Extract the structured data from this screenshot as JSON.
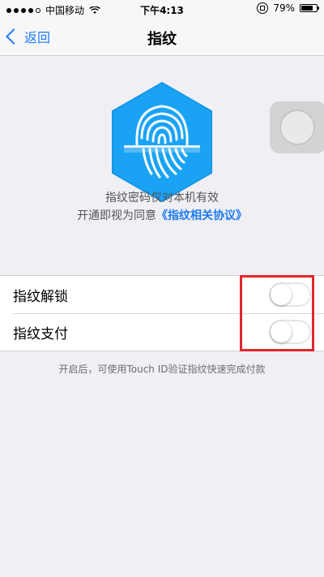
{
  "status_bar": {
    "carrier": "中国移动",
    "time": "下午4:13",
    "battery_percent": "79%",
    "battery_level": 0.79,
    "signal_bars_filled": 4,
    "signal_bars_total": 5
  },
  "nav": {
    "back_label": "返回",
    "title": "指纹"
  },
  "fingerprint": {
    "icon": "fingerprint-icon",
    "hex_color": "#1aa3f5",
    "desc_line1": "指纹密码仅对本机有效",
    "desc_line2_prefix": "开通即视为同意",
    "agreement_link": "《指纹相关协议》"
  },
  "settings": {
    "rows": [
      {
        "label": "指纹解锁",
        "enabled": false
      },
      {
        "label": "指纹支付",
        "enabled": false
      }
    ],
    "footer_note": "开启后，可使用Touch ID验证指纹快速完成付款"
  },
  "colors": {
    "accent": "#1e7bf5",
    "highlight": "#e2262b",
    "background": "#efeff4"
  }
}
